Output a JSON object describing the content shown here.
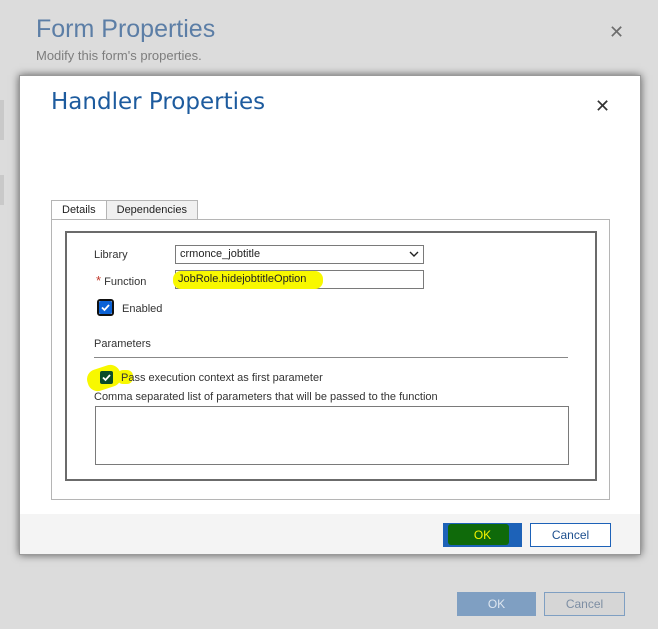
{
  "background_dialog": {
    "title": "Form Properties",
    "subtitle": "Modify this form's properties.",
    "close_glyph": "✕",
    "ok_label": "OK",
    "cancel_label": "Cancel"
  },
  "dialog": {
    "title": "Handler Properties",
    "close_glyph": "✕",
    "tabs": [
      {
        "label": "Details",
        "active": true
      },
      {
        "label": "Dependencies",
        "active": false
      }
    ],
    "library": {
      "label": "Library",
      "value": "crmonce_jobtitle"
    },
    "function": {
      "required_marker": "*",
      "label": "Function",
      "value": "JobRole.hidejobtitleOption"
    },
    "enabled": {
      "label": "Enabled",
      "checked": true
    },
    "parameters": {
      "section_label": "Parameters",
      "pass_context_label": "Pass execution context as first parameter",
      "pass_context_checked": true,
      "list_label": "Comma separated list of parameters that will be passed to the function",
      "list_value": ""
    },
    "ok_label": "OK",
    "cancel_label": "Cancel"
  },
  "colors": {
    "title_blue": "#1d5b9e",
    "primary_button": "#1d62b8",
    "highlight_yellow": "#f8f800",
    "highlight_green": "#0f6a0a"
  },
  "icons": {
    "close": "close-icon",
    "dropdown": "chevron-down-icon",
    "check": "checkmark-icon"
  }
}
